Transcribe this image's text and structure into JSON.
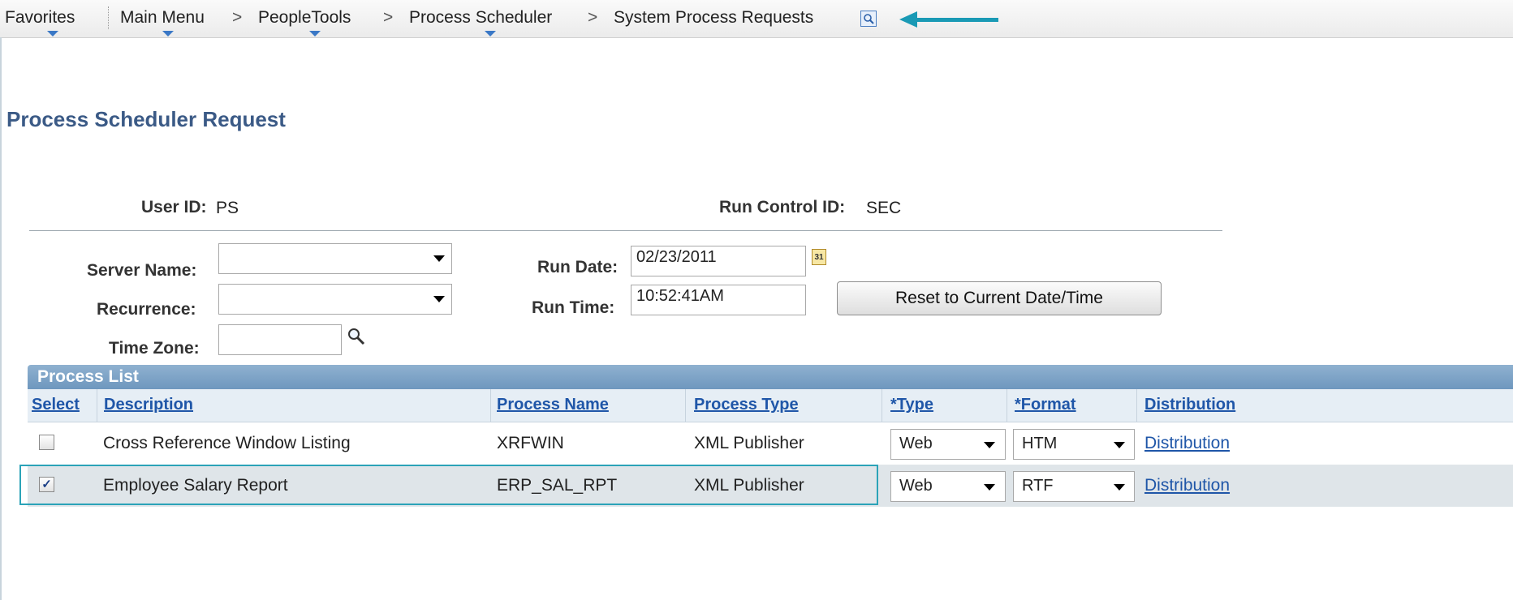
{
  "nav": {
    "favorites": "Favorites",
    "main_menu": "Main Menu",
    "peopletools": "PeopleTools",
    "process_scheduler": "Process Scheduler",
    "current": "System Process Requests",
    "separator": ">"
  },
  "page": {
    "title": "Process Scheduler Request"
  },
  "header_info": {
    "user_id_label": "User ID:",
    "user_id_value": "PS",
    "run_control_label": "Run Control ID:",
    "run_control_value": "SEC"
  },
  "form": {
    "server_name_label": "Server Name:",
    "server_name_value": "",
    "recurrence_label": "Recurrence:",
    "recurrence_value": "",
    "time_zone_label": "Time Zone:",
    "time_zone_value": "",
    "run_date_label": "Run Date:",
    "run_date_value": "02/23/2011",
    "run_time_label": "Run Time:",
    "run_time_value": "10:52:41AM",
    "reset_button": "Reset to Current Date/Time",
    "calendar_glyph": "31"
  },
  "process_list": {
    "title": "Process List",
    "columns": {
      "select": "Select",
      "description": "Description",
      "process_name": "Process Name",
      "process_type": "Process Type",
      "type": "*Type",
      "format": "*Format",
      "distribution": "Distribution"
    },
    "rows": [
      {
        "selected": false,
        "description": "Cross Reference Window Listing",
        "process_name": "XRFWIN",
        "process_type": "XML Publisher",
        "type": "Web",
        "format": "HTM",
        "distribution": "Distribution"
      },
      {
        "selected": true,
        "description": "Employee Salary Report",
        "process_name": "ERP_SAL_RPT",
        "process_type": "XML Publisher",
        "type": "Web",
        "format": "RTF",
        "distribution": "Distribution"
      }
    ]
  },
  "colors": {
    "accent_arrow": "#1a9ab5",
    "title_blue": "#3b5a86",
    "link_blue": "#1f56a8",
    "grid_header": "#6e97be",
    "selected_row": "#dfe5e9"
  }
}
